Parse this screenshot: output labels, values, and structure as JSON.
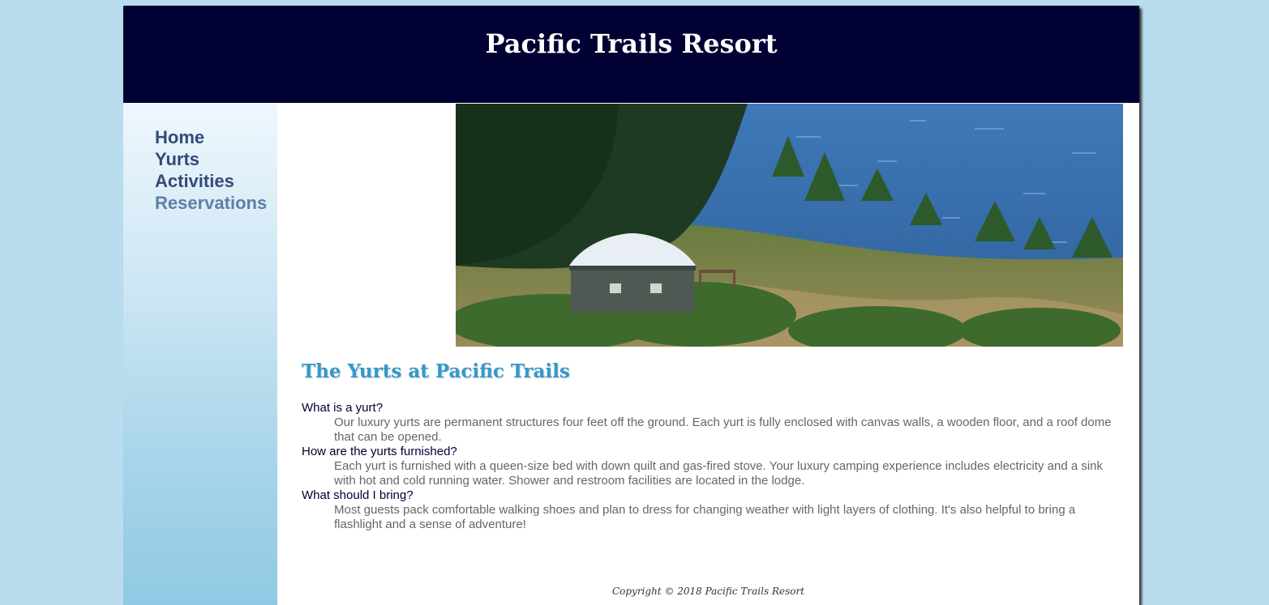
{
  "header": {
    "title": "Pacific Trails Resort"
  },
  "nav": {
    "items": [
      {
        "label": "Home"
      },
      {
        "label": "Yurts"
      },
      {
        "label": "Activities"
      },
      {
        "label": "Reservations"
      }
    ]
  },
  "main": {
    "heading": "The Yurts at Pacific Trails",
    "faq": [
      {
        "question": "What is a yurt?",
        "answer": "Our luxury yurts are permanent structures four feet off the ground. Each yurt is fully enclosed with canvas walls, a wooden floor, and a roof dome that can be opened."
      },
      {
        "question": "How are the yurts furnished?",
        "answer": "Each yurt is furnished with a queen-size bed with down quilt and gas-fired stove. Your luxury camping experience includes electricity and a sink with hot and cold running water. Shower and restroom facilities are located in the lodge."
      },
      {
        "question": "What should I bring?",
        "answer": "Most guests pack comfortable walking shoes and plan to dress for changing weather with light layers of clothing. It's also helpful to bring a flashlight and a sense of adventure!"
      }
    ]
  },
  "footer": {
    "copyright": "Copyright © 2018 Pacific Trails Resort"
  },
  "colors": {
    "page_background": "#b9ddef",
    "header_background": "#000033",
    "heading_color": "#3399cc",
    "nav_link_color": "#344a78",
    "nav_current_color": "#5f7fa6"
  }
}
